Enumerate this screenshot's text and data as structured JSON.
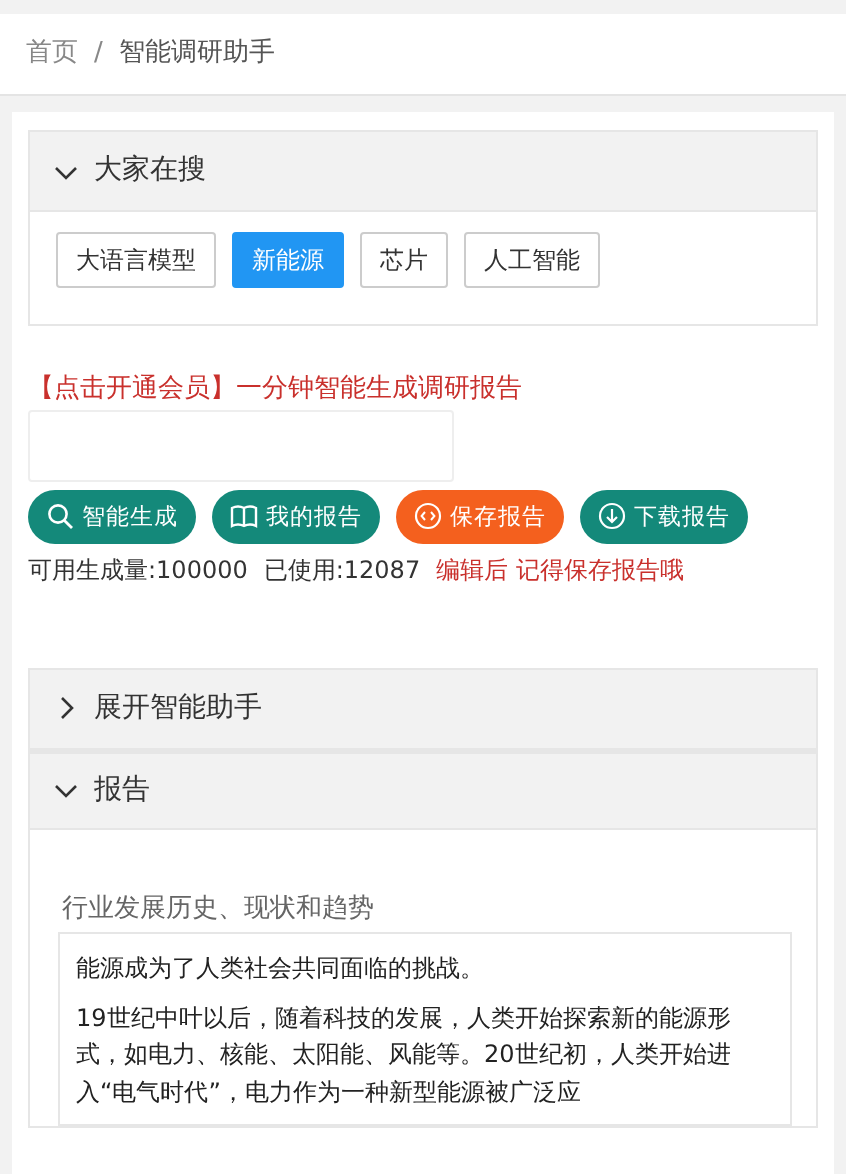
{
  "breadcrumb": [
    "首页",
    "智能调研助手"
  ],
  "breadcrumb_separator": "/",
  "search_panel": {
    "title": "大家在搜",
    "expanded": true,
    "tags": [
      {
        "label": "大语言模型",
        "selected": false
      },
      {
        "label": "新能源",
        "selected": true
      },
      {
        "label": "芯片",
        "selected": false
      },
      {
        "label": "人工智能",
        "selected": false
      }
    ]
  },
  "promo": "【点击开通会员】一分钟智能生成调研报告",
  "buttons": [
    {
      "label": "智能生成",
      "kind": "search",
      "color": "#14897a"
    },
    {
      "label": "我的报告",
      "kind": "book",
      "color": "#14897a"
    },
    {
      "label": "保存报告",
      "kind": "code",
      "color": "#f4601e"
    },
    {
      "label": "下载报告",
      "kind": "download",
      "color": "#14897a"
    }
  ],
  "usage": {
    "available": "可用生成量:100000",
    "used": "已使用:12087",
    "notice": "编辑后 记得保存报告哦"
  },
  "sections": [
    {
      "title": "展开智能助手",
      "expanded": false
    },
    {
      "title": "报告",
      "expanded": true
    }
  ],
  "report": {
    "heading": "行业发展历史、现状和趋势",
    "paragraphs": [
      "能源成为了人类社会共同面临的挑战。",
      "19世纪中叶以后，随着科技的发展，人类开始探索新的能源形式，如电力、核能、太阳能、风能等。20世纪初，人类开始进入“电气时代”，电力作为一种新型能源被广泛应"
    ]
  }
}
